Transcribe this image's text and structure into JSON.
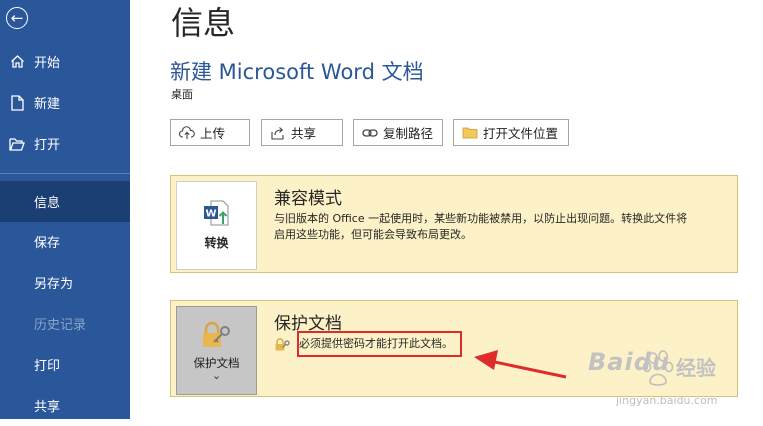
{
  "sidebar": {
    "back_icon": "back-arrow-icon",
    "items": [
      {
        "label": "开始",
        "icon": "home-icon"
      },
      {
        "label": "新建",
        "icon": "new-document-icon"
      },
      {
        "label": "打开",
        "icon": "open-folder-icon"
      },
      {
        "label": "信息",
        "active": true
      },
      {
        "label": "保存"
      },
      {
        "label": "另存为"
      },
      {
        "label": "历史记录",
        "disabled": true
      },
      {
        "label": "打印"
      },
      {
        "label": "共享"
      }
    ]
  },
  "main": {
    "page_title": "信息",
    "doc_title": "新建 Microsoft Word 文档",
    "doc_location": "桌面",
    "actions": [
      {
        "label": "上传",
        "icon": "cloud-upload-icon"
      },
      {
        "label": "共享",
        "icon": "share-icon"
      },
      {
        "label": "复制路径",
        "icon": "link-icon"
      },
      {
        "label": "打开文件位置",
        "icon": "folder-icon"
      }
    ],
    "compat": {
      "tile_label": "转换",
      "title": "兼容模式",
      "desc_line1": "与旧版本的 Office 一起使用时，某些新功能被禁用，以防止出现问题。转换此文件将",
      "desc_line2": "启用这些功能，但可能会导致布局更改。"
    },
    "protect": {
      "tile_label": "保护文档",
      "tile_caret": "⌄",
      "title": "保护文档",
      "desc": "必须提供密码才能打开此文档。"
    }
  },
  "watermark": {
    "brand": "Baidu",
    "brand_cn": "经验",
    "url": "jingyan.baidu.com"
  },
  "colors": {
    "sidebar_bg": "#2a579a",
    "sidebar_active": "#1b3f73",
    "accent_text": "#2b5797",
    "card_bg": "#fdf2c7",
    "annotation_red": "#e02b2b"
  }
}
